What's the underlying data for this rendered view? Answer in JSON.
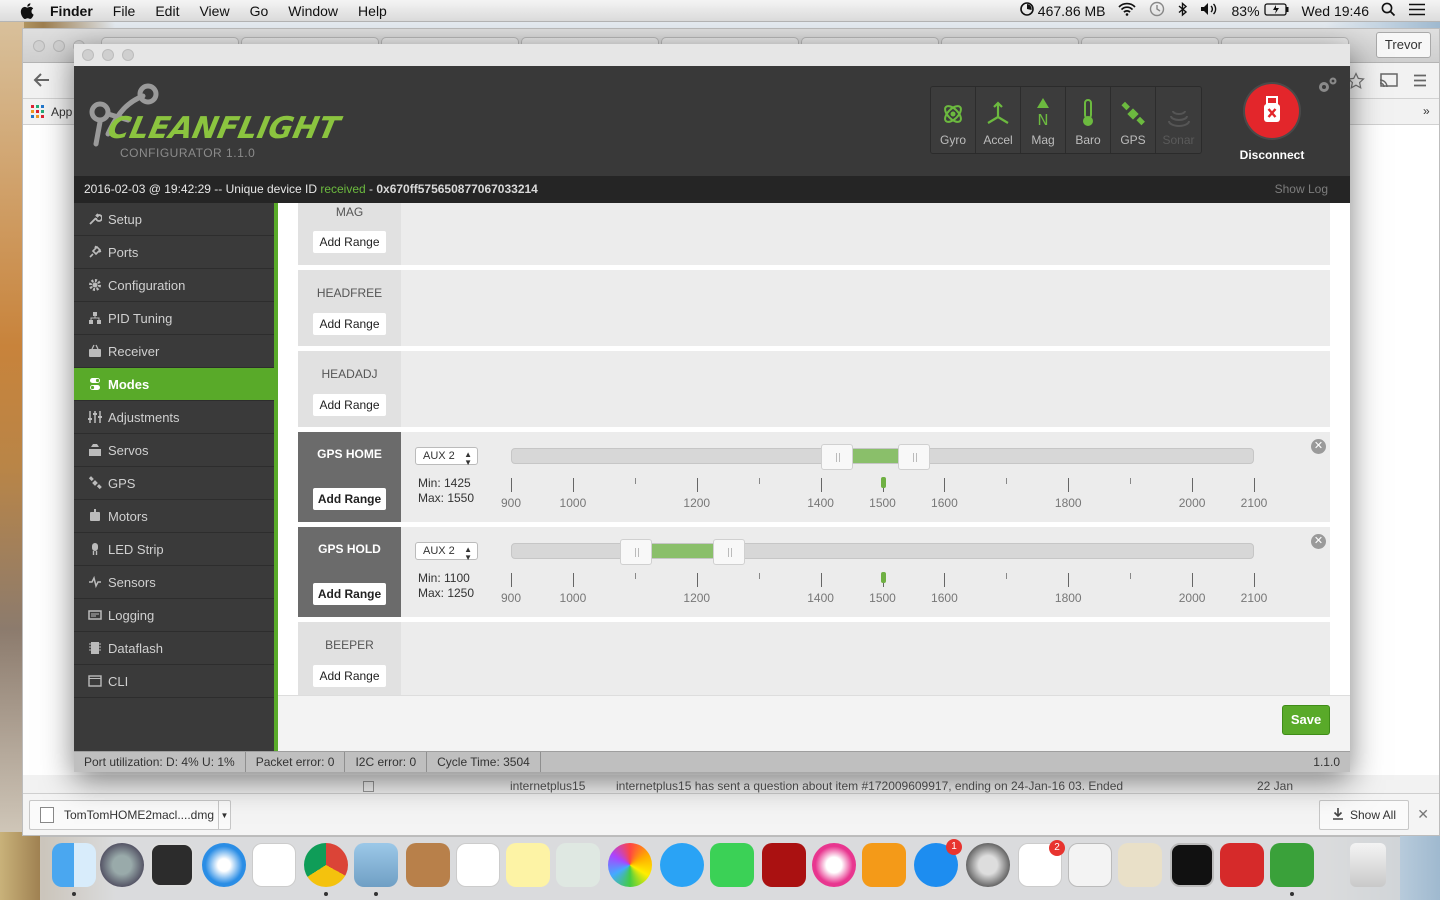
{
  "menubar": {
    "app": "Finder",
    "items": [
      "File",
      "Edit",
      "View",
      "Go",
      "Window",
      "Help"
    ],
    "memory": "467.86 MB",
    "battery": "83%",
    "clock": "Wed 19:46"
  },
  "chrome": {
    "user": "Trevor",
    "bookmarks_label": "App",
    "peek_sender": "internetplus15",
    "peek_text": "internetplus15 has sent a question about item #172009609917, ending on 24-Jan-16 03. Ended",
    "peek_date": "22 Jan",
    "download_file": "TomTomHOME2macl....dmg",
    "show_all": "Show All"
  },
  "app": {
    "logo_text": "CLEANFLIGHT",
    "version_label": "CONFIGURATOR  1.1.0",
    "sensors": [
      {
        "label": "Gyro",
        "icon": "gyro-icon",
        "active": true
      },
      {
        "label": "Accel",
        "icon": "accel-icon",
        "active": true
      },
      {
        "label": "Mag",
        "icon": "mag-icon",
        "active": true
      },
      {
        "label": "Baro",
        "icon": "baro-icon",
        "active": true
      },
      {
        "label": "GPS",
        "icon": "gps-icon",
        "active": true
      },
      {
        "label": "Sonar",
        "icon": "sonar-icon",
        "active": false
      }
    ],
    "disconnect_label": "Disconnect",
    "log": {
      "prefix": "2016-02-03 @ 19:42:29 -- Unique device ID ",
      "status": "received",
      "sep": " - ",
      "device_id": "0x670ff575650877067033214",
      "show_log": "Show Log"
    },
    "nav": [
      {
        "label": "Setup",
        "icon": "wrench-icon"
      },
      {
        "label": "Ports",
        "icon": "plug-icon"
      },
      {
        "label": "Configuration",
        "icon": "gear-icon"
      },
      {
        "label": "PID Tuning",
        "icon": "pid-icon"
      },
      {
        "label": "Receiver",
        "icon": "receiver-icon"
      },
      {
        "label": "Modes",
        "icon": "modes-icon",
        "active": true
      },
      {
        "label": "Adjustments",
        "icon": "sliders-icon"
      },
      {
        "label": "Servos",
        "icon": "servo-icon"
      },
      {
        "label": "GPS",
        "icon": "gps-icon"
      },
      {
        "label": "Motors",
        "icon": "motor-icon"
      },
      {
        "label": "LED Strip",
        "icon": "led-icon"
      },
      {
        "label": "Sensors",
        "icon": "sensor-icon"
      },
      {
        "label": "Logging",
        "icon": "logging-icon"
      },
      {
        "label": "Dataflash",
        "icon": "dataflash-icon"
      },
      {
        "label": "CLI",
        "icon": "cli-icon"
      }
    ],
    "add_range": "Add Range",
    "modes": [
      {
        "name": "MAG"
      },
      {
        "name": "HEADFREE"
      },
      {
        "name": "HEADADJ"
      },
      {
        "name": "GPS HOME",
        "aux": "AUX 2",
        "min_label": "Min: 1425",
        "max_label": "Max: 1550",
        "min": 1425,
        "max": 1550,
        "marker": 1500
      },
      {
        "name": "GPS HOLD",
        "aux": "AUX 2",
        "min_label": "Min: 1100",
        "max_label": "Max: 1250",
        "min": 1100,
        "max": 1250,
        "marker": 1500
      },
      {
        "name": "BEEPER"
      }
    ],
    "scale_labels": [
      "900",
      "1000",
      "1200",
      "1400",
      "1500",
      "1600",
      "1800",
      "2000",
      "2100"
    ],
    "save_label": "Save",
    "status": {
      "port": "Port utilization: D: 4% U: 1%",
      "packet": "Packet error: 0",
      "i2c": "I2C error: 0",
      "cycle": "Cycle Time: 3504",
      "version": "1.1.0"
    }
  },
  "colors": {
    "accent": "#59aa29",
    "disconnect": "#e3262b",
    "header": "#393939"
  }
}
